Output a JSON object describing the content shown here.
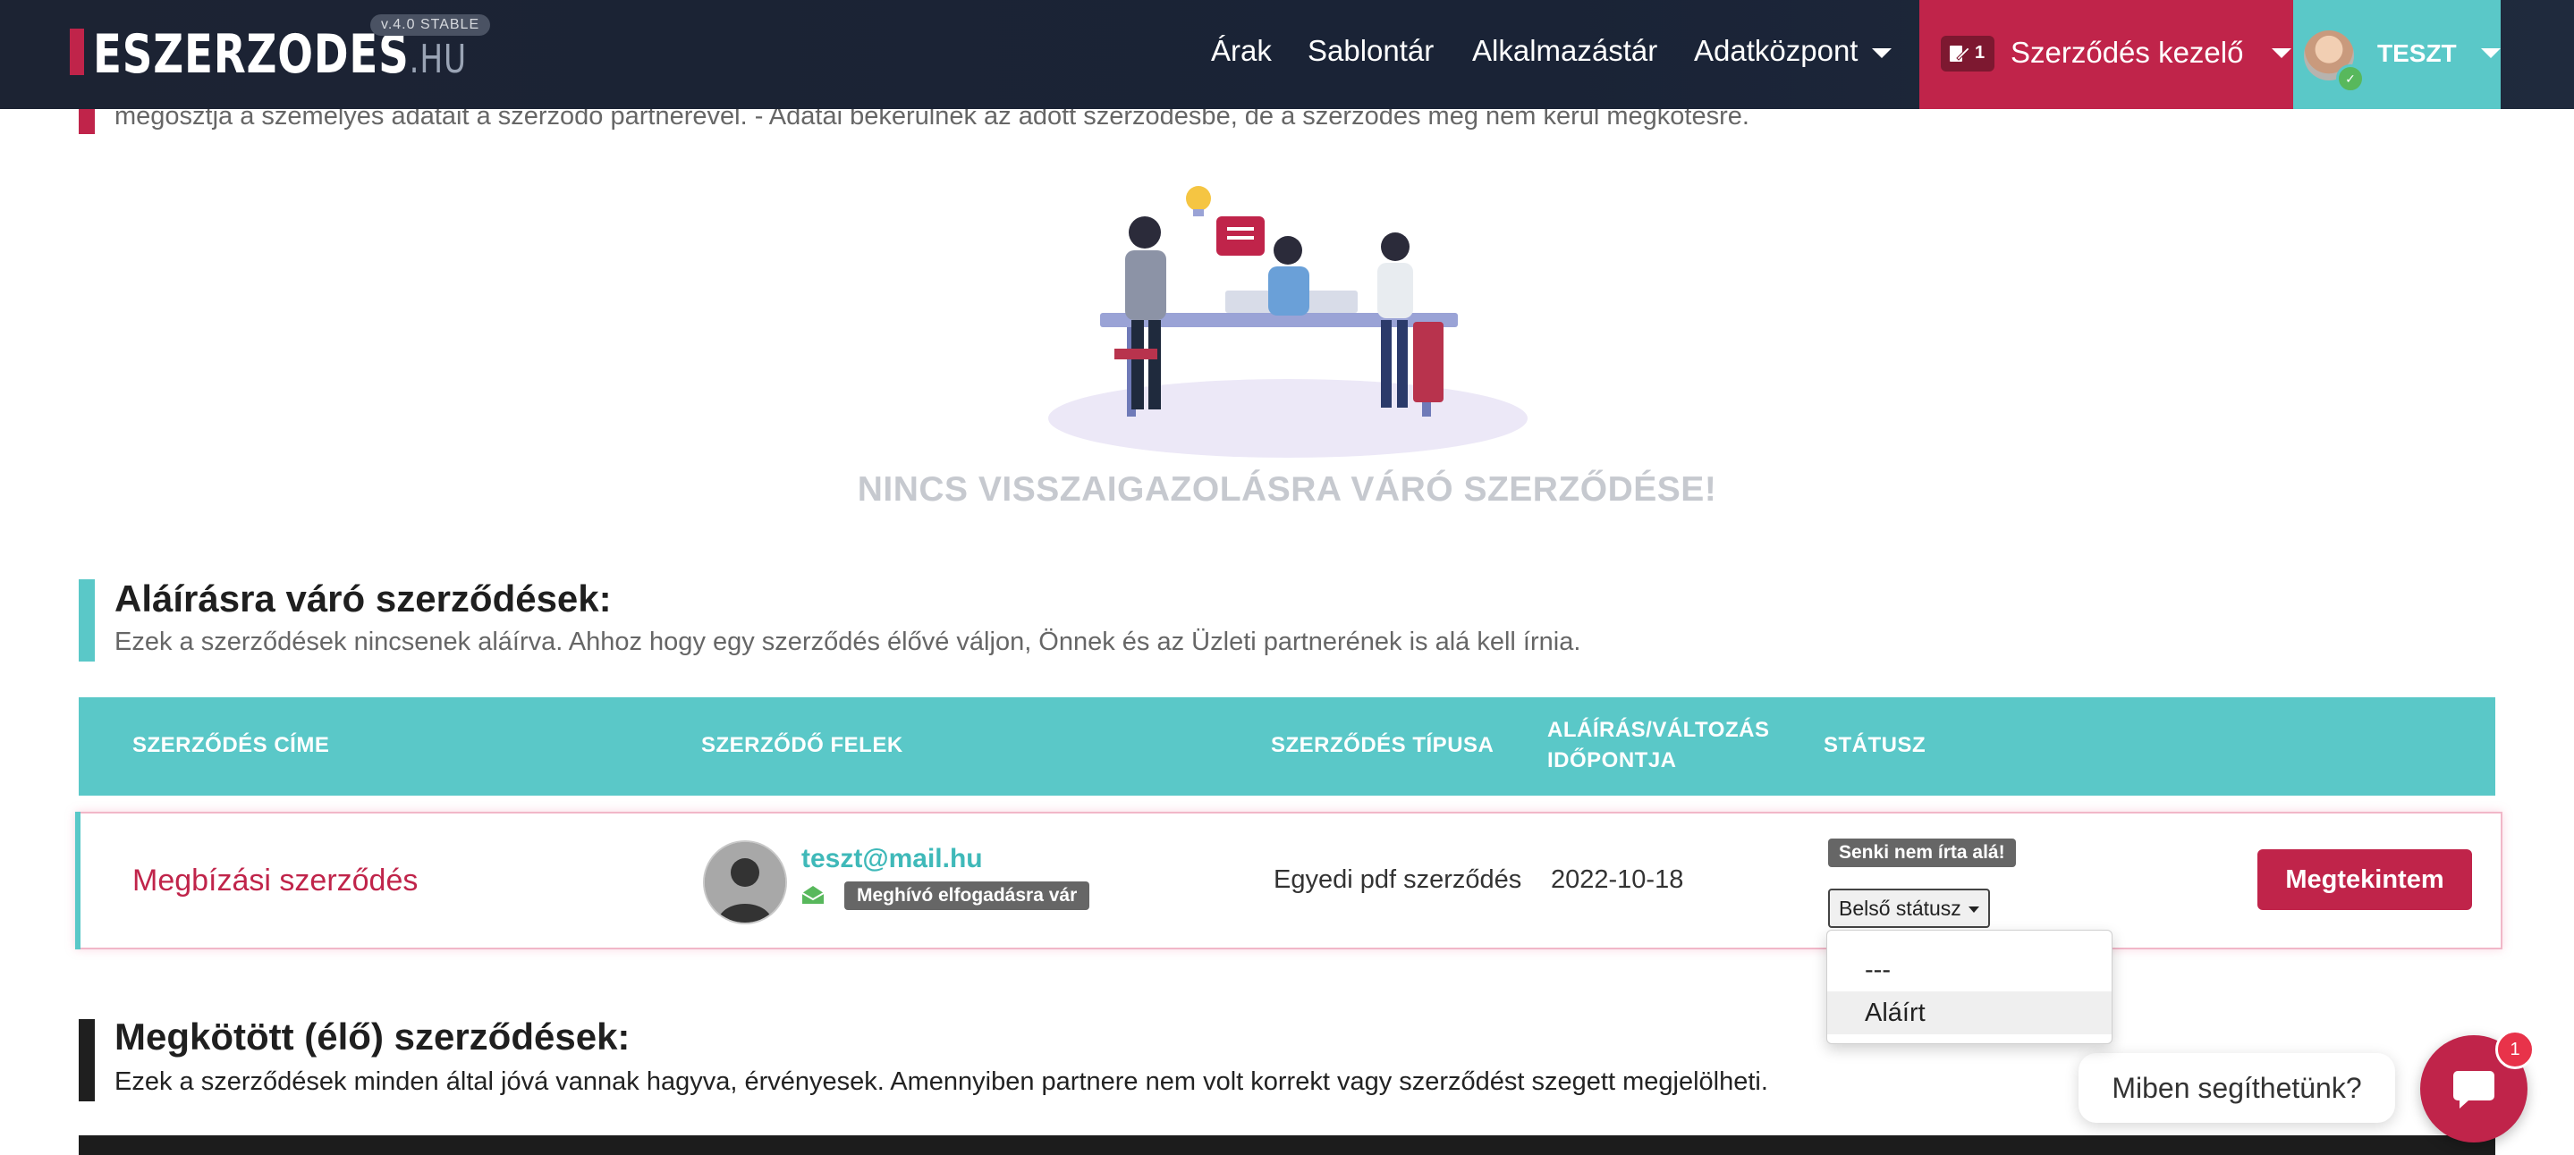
{
  "header": {
    "logo_main": "ESZERZODES",
    "logo_suffix": ".HU",
    "version": "v.4.0 STABLE",
    "nav": [
      "Árak",
      "Sablontár",
      "Alkalmazástár",
      "Adatközpont"
    ],
    "contract_manager": {
      "count": "1",
      "label": "Szerződés kezelő"
    },
    "user": {
      "label": "TESZT"
    }
  },
  "pending_section": {
    "description": "megosztja a személyes adatait a szerződő partnerével. - Adatai bekerülnek az adott szerződésbe, de a szerződés még nem kerül megkötésre.",
    "empty_message": "NINCS VISSZAIGAZOLÁSRA VÁRÓ SZERZŐDÉSE!"
  },
  "awaiting_signature": {
    "title": "Aláírásra váró szerződések:",
    "description": "Ezek a szerződések nincsenek aláírva. Ahhoz hogy egy szerződés élővé váljon, Önnek és az Üzleti partnerének is alá kell írnia.",
    "columns": [
      "SZERZŐDÉS CÍME",
      "SZERZŐDŐ FELEK",
      "SZERZŐDÉS TÍPUSA",
      "ALÁÍRÁS/VÁLTOZÁS",
      "IDŐPONTJA",
      "STÁTUSZ"
    ],
    "rows": [
      {
        "title": "Megbízási szerződés",
        "party_email": "teszt@mail.hu",
        "party_badge": "Meghívó elfogadásra vár",
        "type": "Egyedi pdf szerződés",
        "date": "2022-10-18",
        "status_badge": "Senki nem írta alá!",
        "internal_status": "Belső státusz",
        "action": "Megtekintem"
      }
    ],
    "internal_status_options": [
      "---",
      "Aláírt"
    ],
    "internal_status_highlighted": "Aláírt"
  },
  "live_contracts": {
    "title": "Megkötött (élő) szerződések:",
    "description": "Ezek a szerződések minden által jóvá vannak hagyva, érvényesek. Amennyiben partnere nem volt korrekt vagy szerződést szegett megjelölheti."
  },
  "chat": {
    "prompt": "Miben segíthetünk?",
    "unread": "1"
  },
  "colors": {
    "brand_red": "#c0244a",
    "teal": "#5ac8c8",
    "nav_dark": "#1c2333"
  }
}
